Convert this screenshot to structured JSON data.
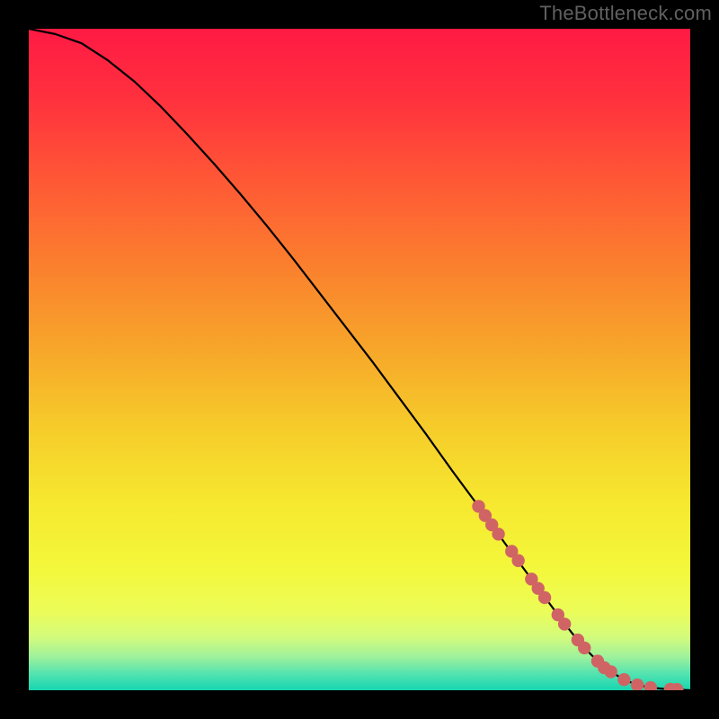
{
  "watermark": "TheBottleneck.com",
  "chart_data": {
    "type": "line",
    "title": "",
    "xlabel": "",
    "ylabel": "",
    "xlim": [
      0,
      100
    ],
    "ylim": [
      0,
      100
    ],
    "curve": {
      "name": "bottleneck-curve",
      "x": [
        0,
        4,
        8,
        12,
        16,
        20,
        24,
        28,
        32,
        36,
        40,
        44,
        48,
        52,
        56,
        60,
        64,
        68,
        72,
        76,
        80,
        82,
        84,
        86,
        88,
        90,
        92,
        94,
        96,
        98,
        100
      ],
      "y": [
        100,
        99.2,
        97.8,
        95.2,
        92.0,
        88.2,
        84.0,
        79.6,
        75.0,
        70.2,
        65.2,
        60.0,
        54.8,
        49.6,
        44.2,
        38.8,
        33.2,
        27.8,
        22.2,
        16.8,
        11.4,
        8.8,
        6.4,
        4.4,
        2.8,
        1.6,
        0.8,
        0.4,
        0.2,
        0.1,
        0.0
      ]
    },
    "points": {
      "name": "cluster-points",
      "color": "#d06464",
      "x": [
        68,
        69,
        70,
        71,
        73,
        74,
        76,
        77,
        78,
        80,
        81,
        83,
        84,
        86,
        87,
        88,
        90,
        92,
        94,
        97,
        98
      ],
      "y": [
        27.8,
        26.4,
        25.0,
        23.6,
        21.0,
        19.6,
        16.8,
        15.4,
        14.0,
        11.4,
        10.0,
        7.6,
        6.4,
        4.4,
        3.4,
        2.8,
        1.6,
        0.8,
        0.4,
        0.15,
        0.1
      ]
    },
    "gradient_stops": [
      {
        "offset": 0.0,
        "color": "#ff1a44"
      },
      {
        "offset": 0.1,
        "color": "#ff2f3e"
      },
      {
        "offset": 0.22,
        "color": "#ff5536"
      },
      {
        "offset": 0.35,
        "color": "#fb7d2e"
      },
      {
        "offset": 0.48,
        "color": "#f7a52a"
      },
      {
        "offset": 0.6,
        "color": "#f6cb2a"
      },
      {
        "offset": 0.72,
        "color": "#f6e92f"
      },
      {
        "offset": 0.82,
        "color": "#f3f83c"
      },
      {
        "offset": 0.88,
        "color": "#ecfc58"
      },
      {
        "offset": 0.92,
        "color": "#d3fb7c"
      },
      {
        "offset": 0.95,
        "color": "#9df19c"
      },
      {
        "offset": 0.975,
        "color": "#53e3b0"
      },
      {
        "offset": 1.0,
        "color": "#16d6b0"
      }
    ]
  }
}
